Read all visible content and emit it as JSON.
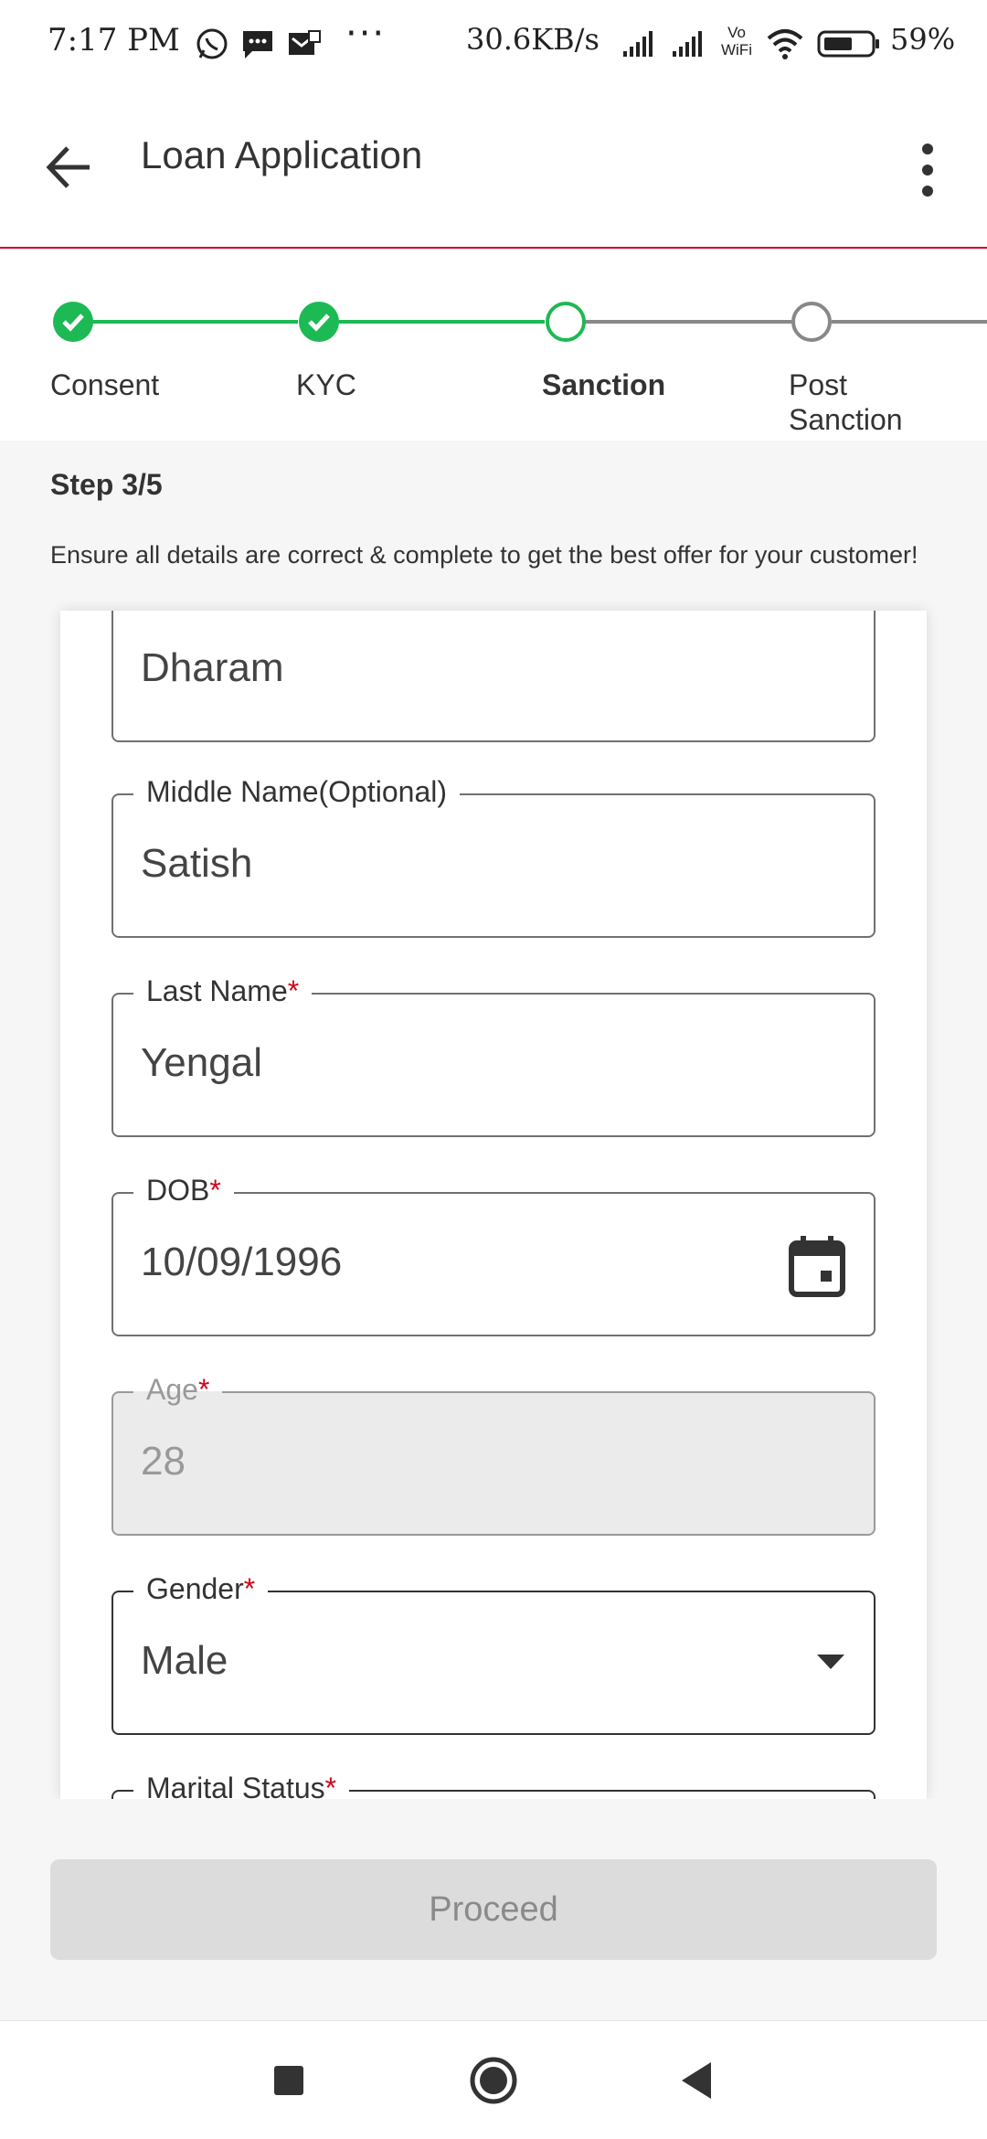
{
  "status_bar": {
    "time": "7:17 PM",
    "dots": "···",
    "speed": "30.6KB/s",
    "network": "Vo WiFi",
    "battery": "59%",
    "icons": [
      "whatsapp-icon",
      "message-icon",
      "mail-icon",
      "signal-icon",
      "signal-icon",
      "vowifi-icon",
      "wifi-icon",
      "battery-icon"
    ]
  },
  "appbar": {
    "title": "Loan Application"
  },
  "stepper": {
    "steps": [
      {
        "label": "Consent",
        "state": "done"
      },
      {
        "label": "KYC",
        "state": "done"
      },
      {
        "label": "Sanction",
        "state": "current"
      },
      {
        "label": "Post\nSanction",
        "state": "todo"
      }
    ]
  },
  "info": {
    "step": "Step 3/5",
    "hint": "Ensure all details are correct & complete to get the best offer for your customer!"
  },
  "form": {
    "first_name": {
      "value": "Dharam"
    },
    "middle_name": {
      "label": "Middle Name(Optional)",
      "value": "Satish"
    },
    "last_name": {
      "label": "Last Name",
      "required": "*",
      "value": "Yengal"
    },
    "dob": {
      "label": "DOB",
      "required": "*",
      "value": "10/09/1996"
    },
    "age": {
      "label": "Age",
      "required": "*",
      "value": "28"
    },
    "gender": {
      "label": "Gender",
      "required": "*",
      "value": "Male"
    },
    "marital_status": {
      "label": "Marital Status",
      "required": "*"
    }
  },
  "actions": {
    "proceed": "Proceed"
  },
  "colors": {
    "accent_red": "#d0021b",
    "step_green": "#1db954",
    "disabled_bg": "#dcdcdc"
  }
}
